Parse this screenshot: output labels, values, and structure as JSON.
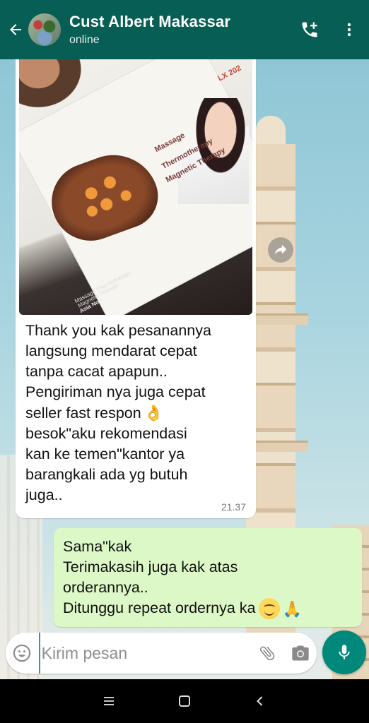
{
  "header": {
    "contact_name": "Cust Albert Makassar",
    "status": "online",
    "icons": [
      "back-arrow-icon",
      "add-call-icon",
      "more-vert-icon"
    ]
  },
  "messages": [
    {
      "direction": "incoming",
      "has_image": true,
      "image_text": {
        "line1": "Massage",
        "line2": "Thermotherapy",
        "line3": "Magnetic Therapy",
        "model": "LX 202",
        "box_small1": "Massage Thermotherapy",
        "box_small2": "Magnetic Therapy",
        "box_small3": "Asia No:1"
      },
      "lines": [
        "Thank you kak pesanannya",
        "langsung mendarat cepat",
        "tanpa cacat apapun..",
        "Pengiriman nya juga cepat",
        "seller fast respon",
        "besok\"aku rekomendasi",
        "kan ke temen\"kantor ya",
        "barangkali ada yg butuh",
        "juga.."
      ],
      "emoji_after_line5": "👌",
      "time": "21.37"
    },
    {
      "direction": "outgoing",
      "lines": [
        "Sama\"kak",
        "Terimakasih juga kak atas",
        "orderannya..",
        "Ditunggu repeat ordernya ka"
      ],
      "emoji_end": [
        "smiling-face",
        "🙏"
      ]
    }
  ],
  "composer": {
    "placeholder": "Kirim pesan",
    "icons": [
      "emoji-icon",
      "attach-icon",
      "camera-icon",
      "mic-icon"
    ]
  },
  "system_nav": [
    "recents-icon",
    "home-icon",
    "back-icon"
  ],
  "colors": {
    "header": "#075e54",
    "outgoing_bubble": "#dcf8c6",
    "incoming_bubble": "#ffffff",
    "mic_button": "#00897b"
  }
}
